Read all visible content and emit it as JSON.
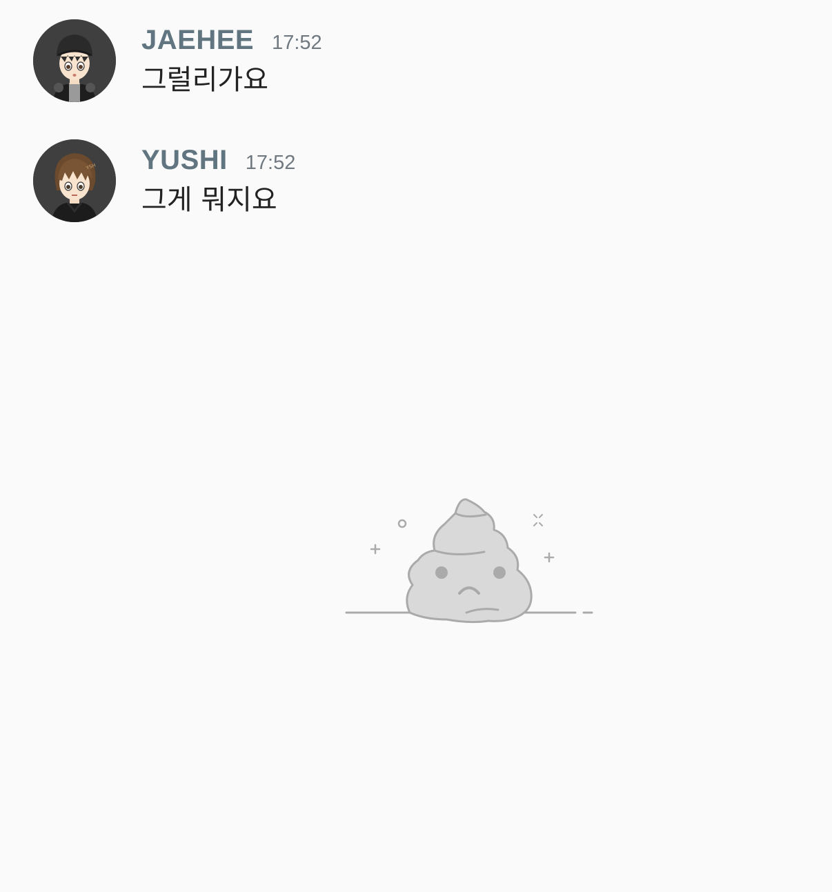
{
  "messages": [
    {
      "username": "JAEHEE",
      "time": "17:52",
      "text": "그럴리가요",
      "avatar_icon": "cartoon-boy-with-cap-avatar"
    },
    {
      "username": "YUSHI",
      "time": "17:52",
      "text": "그게 뭐지요",
      "avatar_icon": "cartoon-boy-brown-hair-avatar"
    }
  ],
  "empty_state": {
    "icon": "sad-poop-icon"
  },
  "colors": {
    "background": "#fafafa",
    "username": "#607580",
    "timestamp": "#707880",
    "message_text": "#222222",
    "avatar_bg": "#3f3f3f",
    "illustration_fill": "#d9d9d9",
    "illustration_stroke": "#aaaaaa"
  }
}
